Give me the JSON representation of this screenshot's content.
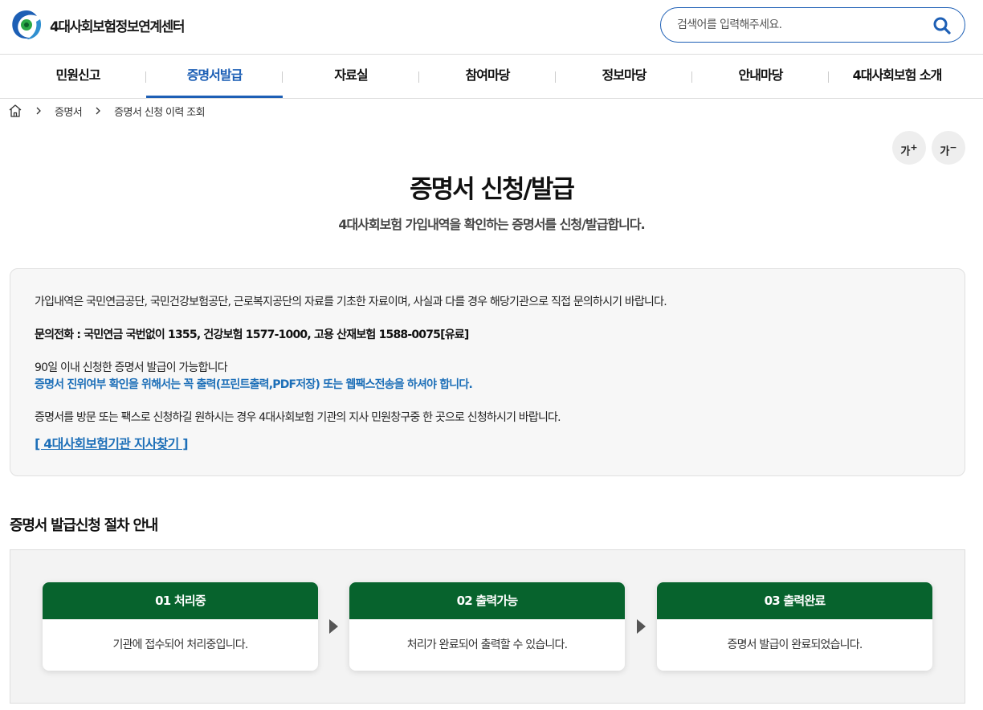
{
  "header": {
    "logo_text": "4대사회보험정보연계센터",
    "search_placeholder": "검색어를 입력해주세요."
  },
  "nav": {
    "items": [
      {
        "label": "민원신고",
        "active": false
      },
      {
        "label": "증명서발급",
        "active": true
      },
      {
        "label": "자료실",
        "active": false
      },
      {
        "label": "참여마당",
        "active": false
      },
      {
        "label": "정보마당",
        "active": false
      },
      {
        "label": "안내마당",
        "active": false
      },
      {
        "label": "4대사회보험 소개",
        "active": false
      }
    ]
  },
  "breadcrumb": {
    "items": [
      "증명서",
      "증명서 신청 이력 조회"
    ]
  },
  "font_size": {
    "increase_label": "가",
    "increase_mark": "+",
    "decrease_label": "가",
    "decrease_mark": "−"
  },
  "page": {
    "title": "증명서 신청/발급",
    "subtitle": "4대사회보험 가입내역을 확인하는 증명서를 신청/발급합니다."
  },
  "info": {
    "line1": "가입내역은 국민연금공단, 국민건강보험공단, 근로복지공단의 자료를 기초한 자료이며, 사실과 다를 경우 해당기관으로 직접 문의하시기 바랍니다.",
    "line2": "문의전화 : 국민연금 국번없이 1355, 건강보험 1577-1000, 고용 산재보험 1588-0075[유료]",
    "line3": "90일 이내 신청한 증명서 발급이 가능합니다",
    "line4": "증명서 진위여부 확인을 위해서는 꼭 출력(프린트출력,PDF저장) 또는 웹팩스전송을 하셔야 합니다.",
    "line5": "증명서를 방문 또는 팩스로 신청하길 원하시는 경우 4대사회보험 기관의 지사 민원창구중 한 곳으로 신청하시기 바랍니다.",
    "link": "[ 4대사회보험기관 지사찾기 ]"
  },
  "procedure": {
    "title": "증명서 발급신청 절차 안내",
    "steps": [
      {
        "head": "01 처리중",
        "body": "기관에 접수되어 처리중입니다."
      },
      {
        "head": "02 출력가능",
        "body": "처리가 완료되어 출력할 수 있습니다."
      },
      {
        "head": "03 출력완료",
        "body": "증명서 발급이 완료되었습니다."
      }
    ]
  },
  "colors": {
    "primary_blue": "#1d5fb5",
    "link_blue": "#1d6fb8",
    "step_green": "#07632d"
  }
}
